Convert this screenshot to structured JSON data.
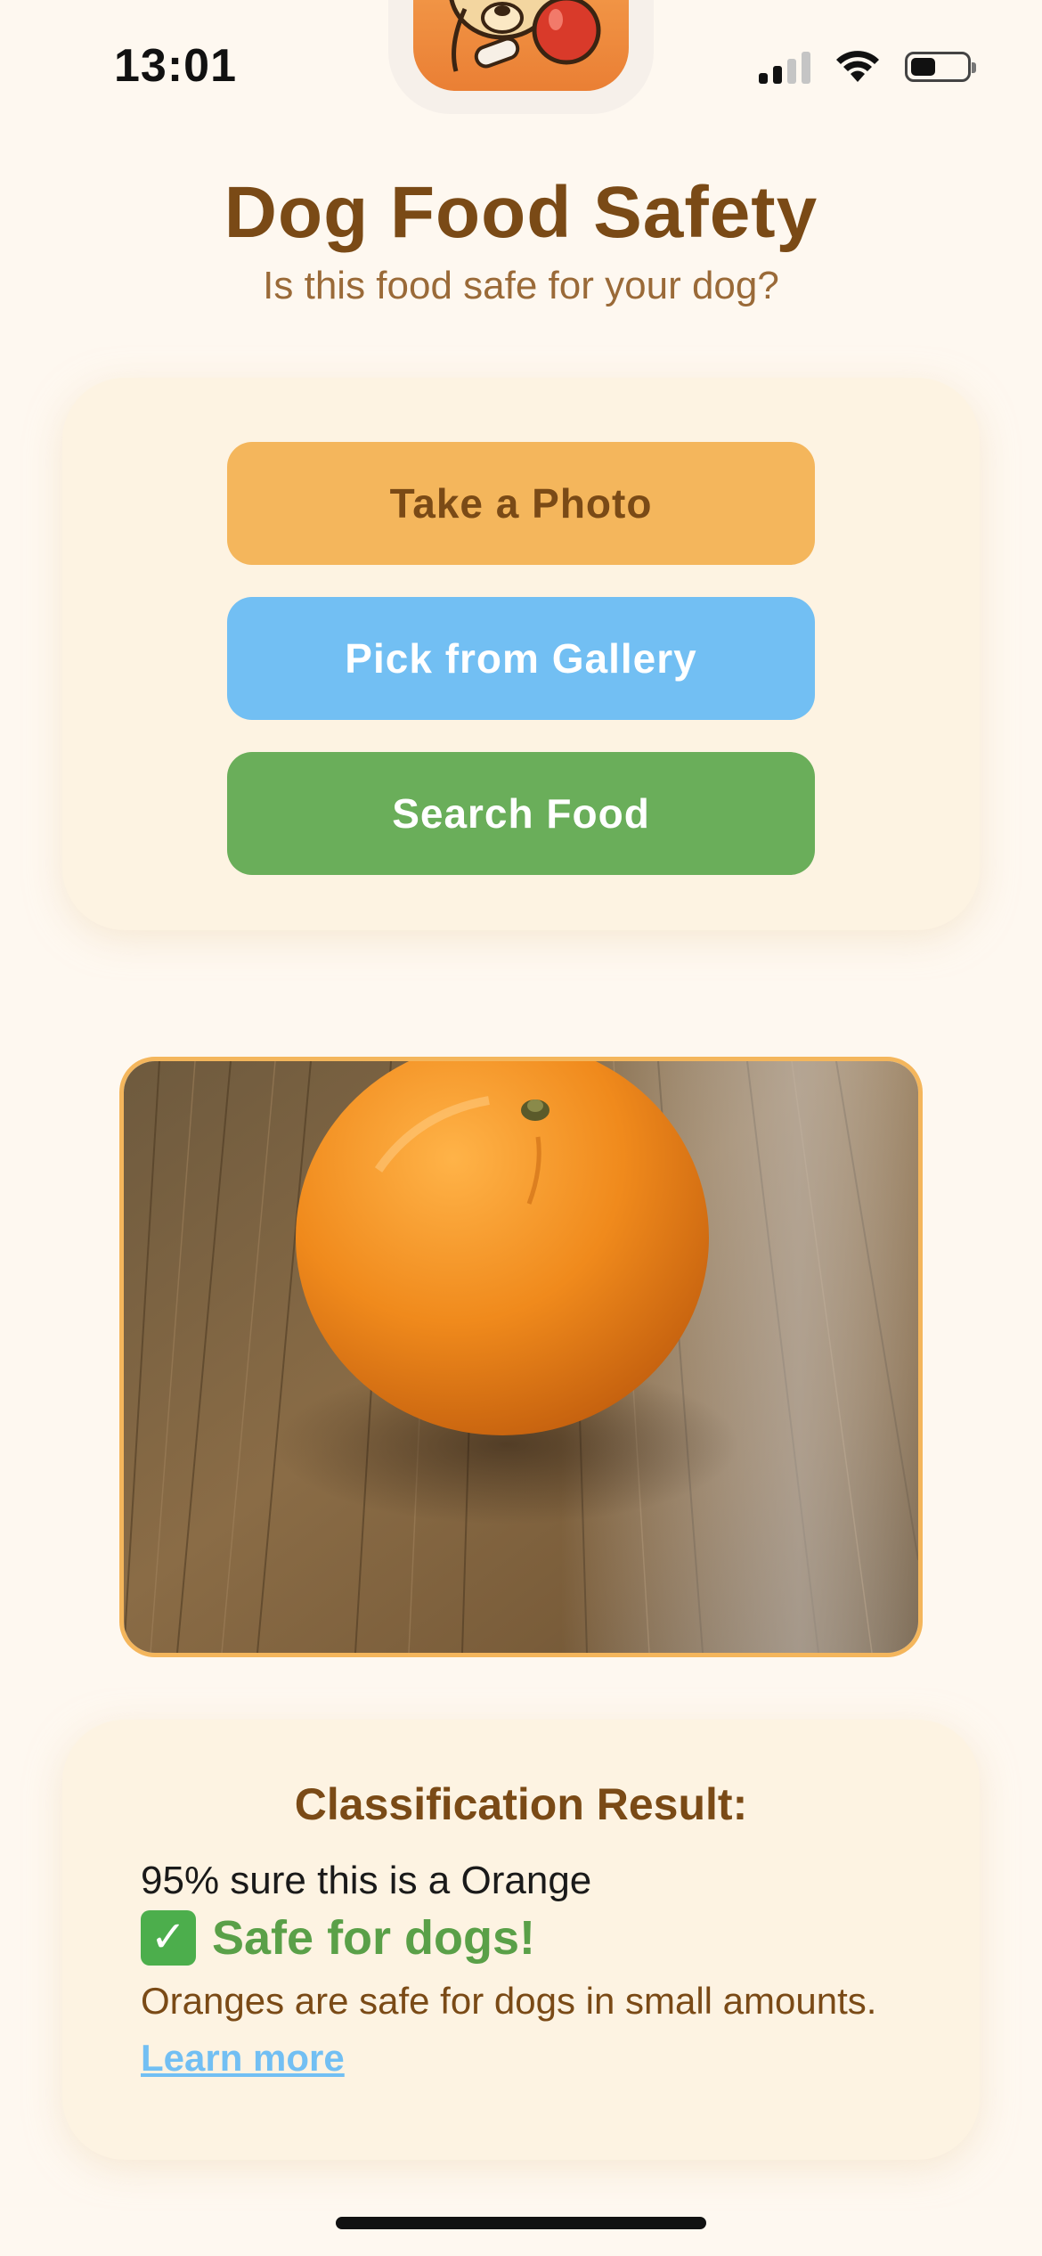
{
  "status_bar": {
    "time": "13:01",
    "icons": [
      "cellular-signal-icon",
      "wifi-icon",
      "battery-icon"
    ]
  },
  "app_icon": "dog-with-apple-icon",
  "header": {
    "title": "Dog Food Safety",
    "subtitle": "Is this food safe for your dog?"
  },
  "actions": {
    "take_photo": "Take a Photo",
    "pick_gallery": "Pick from Gallery",
    "search_food": "Search Food"
  },
  "photo": {
    "subject": "orange on wooden table"
  },
  "result": {
    "title": "Classification Result:",
    "confidence": "95% sure this is a Orange",
    "safe_label": "Safe for dogs!",
    "description": "Oranges are safe for dogs in small amounts.",
    "link": "Learn more"
  },
  "colors": {
    "background": "#fef8f0",
    "brown_text": "#7a4a16",
    "orange_button": "#f4b65c",
    "blue_button": "#72bff3",
    "green_button": "#6aae5a",
    "safe_green": "#5aa048"
  }
}
